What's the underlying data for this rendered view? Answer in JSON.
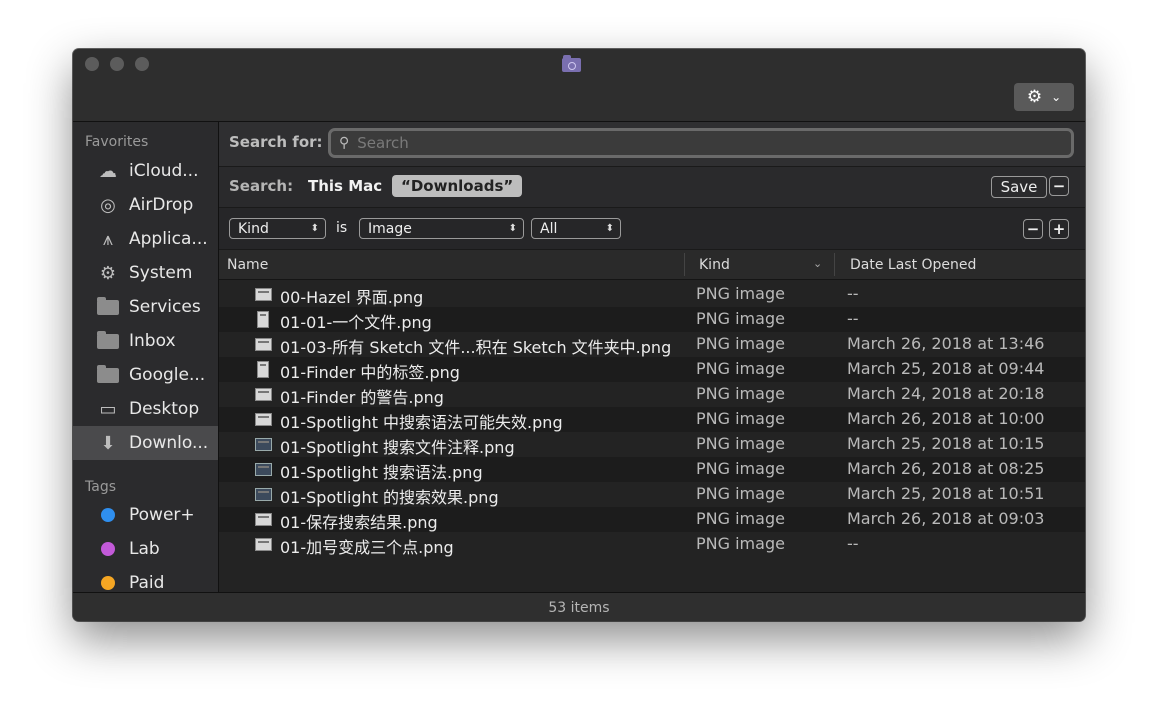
{
  "toolbar": {
    "gear_icon": "gear-icon",
    "gear_chevron": "⌄"
  },
  "sidebar": {
    "favorites_header": "Favorites",
    "favorites": [
      {
        "label": "iCloud...",
        "icon": "cloud-icon"
      },
      {
        "label": "AirDrop",
        "icon": "airdrop-icon"
      },
      {
        "label": "Applica...",
        "icon": "applications-icon"
      },
      {
        "label": "System",
        "icon": "gear-icon"
      },
      {
        "label": "Services",
        "icon": "folder-icon"
      },
      {
        "label": "Inbox",
        "icon": "folder-icon"
      },
      {
        "label": "Google...",
        "icon": "folder-icon"
      },
      {
        "label": "Desktop",
        "icon": "desktop-icon"
      },
      {
        "label": "Downlo...",
        "icon": "downloads-icon",
        "selected": true
      }
    ],
    "tags_header": "Tags",
    "tags": [
      {
        "label": "Power+",
        "color": "#2f8fef"
      },
      {
        "label": "Lab",
        "color": "#c35ad9"
      },
      {
        "label": "Paid",
        "color": "#f5a623"
      }
    ]
  },
  "search": {
    "label": "Search for:",
    "placeholder": "Search",
    "value": ""
  },
  "scope": {
    "label": "Search:",
    "this_mac": "This Mac",
    "downloads": "“Downloads”",
    "save_label": "Save",
    "minus": "−"
  },
  "criteria": {
    "attribute": "Kind",
    "operator": "is",
    "value": "Image",
    "scope": "All",
    "minus": "−",
    "plus": "+"
  },
  "table": {
    "columns": {
      "name": "Name",
      "kind": "Kind",
      "date": "Date Last Opened"
    },
    "rows": [
      {
        "name": "00-Hazel 界面.png",
        "kind": "PNG image",
        "date": "--",
        "thumb": "wide"
      },
      {
        "name": "01-01-一个文件.png",
        "kind": "PNG image",
        "date": "--",
        "thumb": "tall"
      },
      {
        "name": "01-03-所有 Sketch 文件...积在 Sketch 文件夹中.png",
        "kind": "PNG image",
        "date": "March 26, 2018 at 13:46",
        "thumb": "wide"
      },
      {
        "name": "01-Finder 中的标签.png",
        "kind": "PNG image",
        "date": "March 25, 2018 at 09:44",
        "thumb": "tall"
      },
      {
        "name": "01-Finder 的警告.png",
        "kind": "PNG image",
        "date": "March 24, 2018 at 20:18",
        "thumb": "wide"
      },
      {
        "name": "01-Spotlight 中搜索语法可能失效.png",
        "kind": "PNG image",
        "date": "March 26, 2018 at 10:00",
        "thumb": "wide"
      },
      {
        "name": "01-Spotlight 搜索文件注释.png",
        "kind": "PNG image",
        "date": "March 25, 2018 at 10:15",
        "thumb": "dark"
      },
      {
        "name": "01-Spotlight 搜索语法.png",
        "kind": "PNG image",
        "date": "March 26, 2018 at 08:25",
        "thumb": "dark"
      },
      {
        "name": "01-Spotlight 的搜索效果.png",
        "kind": "PNG image",
        "date": "March 25, 2018 at 10:51",
        "thumb": "dark"
      },
      {
        "name": "01-保存搜索结果.png",
        "kind": "PNG image",
        "date": "March 26, 2018 at 09:03",
        "thumb": "wide"
      },
      {
        "name": "01-加号变成三个点.png",
        "kind": "PNG image",
        "date": "--",
        "thumb": "wide"
      }
    ]
  },
  "status": {
    "items": "53 items"
  }
}
